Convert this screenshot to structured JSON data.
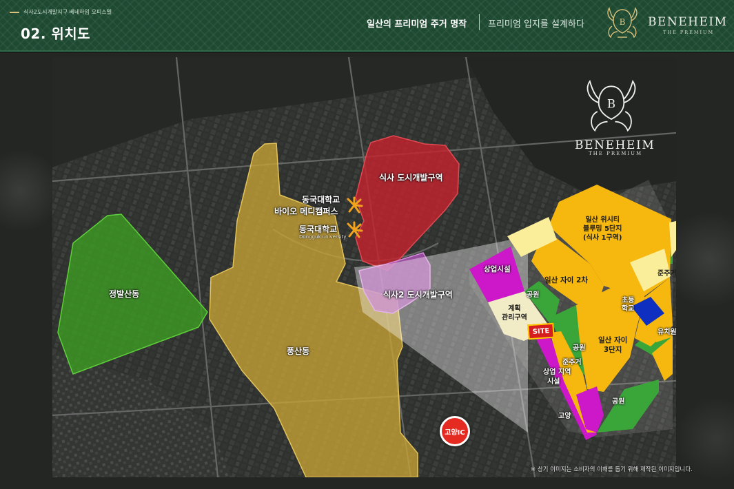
{
  "header": {
    "breadcrumb": "식사2도시개발지구 베네하임 오피스텔",
    "page_title": "02. 위치도",
    "slogan_main": "일산의 프리미엄 주거 명작",
    "slogan_sub": "프리미엄 입지를 설계하다",
    "logo_text": "BENEHEIM",
    "logo_sub": "THE PREMIUM"
  },
  "map": {
    "logo_text": "BENEHEIM",
    "logo_sub": "THE PREMIUM",
    "districts": {
      "jeongbal": "정발산동",
      "pungsan": "풍산동",
      "siksa": "식사 도시개발구역",
      "siksa2": "식사2 도시개발구역"
    },
    "university": {
      "bio_line1": "동국대학교",
      "bio_line2": "바이오 메디캠퍼스",
      "main": "동국대학교",
      "main_en": "Dongguk university"
    },
    "ic": "고양IC",
    "zoom": {
      "bluming": "일산 위시티\n블루밍 5단지\n(식사 1구역)",
      "xi2": "일산 자이 2차",
      "xi3": "일산 자이\n3단지",
      "commercial": "상업시설",
      "plan": "계획\n관리구역",
      "site": "SITE",
      "park1": "공원",
      "park2": "공원",
      "park3": "공원",
      "park4": "공원",
      "park5": "공원",
      "mixed_comm": "상업 지역",
      "residential1": "준주거",
      "residential2": "시설",
      "residential3": "준주거지역",
      "school": "초등\n학교",
      "kinder": "유치원",
      "goyang": "고양"
    },
    "disclaimer": "※ 상기 이미지는 소비자의 이해를 돕기 위해 제작된 이미지입니다."
  },
  "colors": {
    "header_green": "#1f4a32",
    "jeongbal": "#3d9a23",
    "pungsan": "#c8a335",
    "siksa": "#c4232e",
    "siksa2": "#b154b8",
    "zoom_yellow": "#f6b80f",
    "zoom_light": "#fbee9a",
    "zoom_magenta": "#cc18c8",
    "zoom_green": "#3aa63a",
    "zoom_blue": "#0e2fbf",
    "ic_red": "#e52a22"
  }
}
